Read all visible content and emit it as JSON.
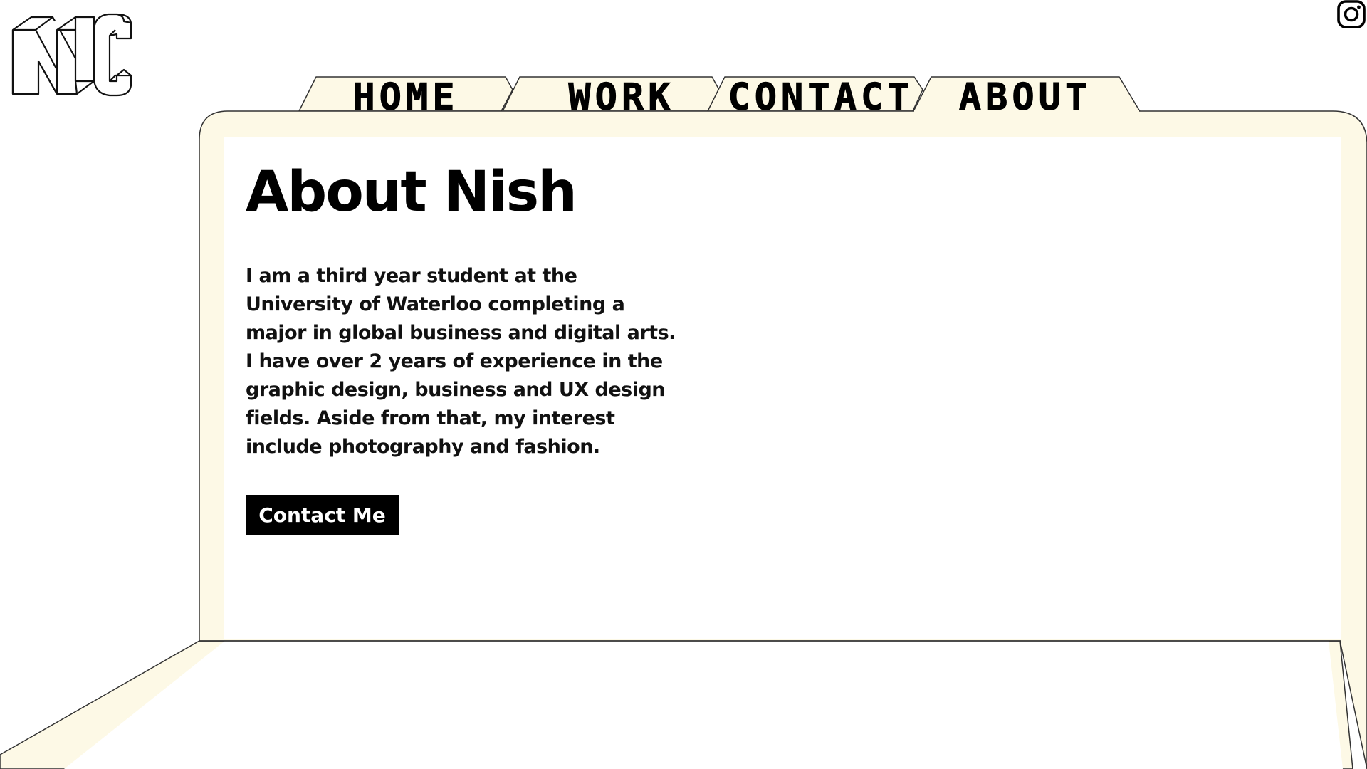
{
  "logo": {
    "text": "NC"
  },
  "nav": {
    "tabs": [
      {
        "label": "HOME"
      },
      {
        "label": "WORK"
      },
      {
        "label": "CONTACT"
      },
      {
        "label": "ABOUT",
        "active": true
      }
    ]
  },
  "social": {
    "icon": "instagram-icon"
  },
  "main": {
    "title": "About Nish",
    "bio": "I am a third year student at the University of Waterloo completing a major in global business and digital arts.  I have over 2 years of experience in the graphic design, business and UX design fields.  Aside from that, my interest include photography and fashion.",
    "cta_label": "Contact Me"
  },
  "colors": {
    "frame": "#fdf9e6",
    "outline": "#333333",
    "button_bg": "#000000",
    "button_text": "#ffffff"
  }
}
